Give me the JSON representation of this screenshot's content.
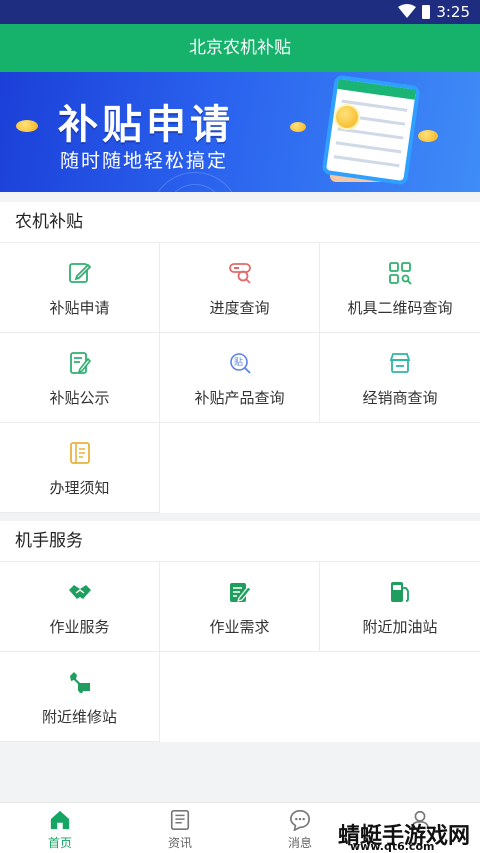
{
  "status_bar": {
    "time": "3:25"
  },
  "header": {
    "title": "北京农机补贴"
  },
  "banner": {
    "title": "补贴申请",
    "subtitle": "随时随地轻松搞定"
  },
  "sections": [
    {
      "title": "农机补贴",
      "items": [
        {
          "label": "补贴申请",
          "icon": "edit-icon"
        },
        {
          "label": "进度查询",
          "icon": "progress-search-icon"
        },
        {
          "label": "机具二维码查询",
          "icon": "qr-code-icon"
        },
        {
          "label": "补贴公示",
          "icon": "notice-icon"
        },
        {
          "label": "补贴产品查询",
          "icon": "product-search-icon"
        },
        {
          "label": "经销商查询",
          "icon": "store-icon"
        },
        {
          "label": "办理须知",
          "icon": "guide-icon"
        }
      ]
    },
    {
      "title": "机手服务",
      "items": [
        {
          "label": "作业服务",
          "icon": "handshake-icon"
        },
        {
          "label": "作业需求",
          "icon": "task-edit-icon"
        },
        {
          "label": "附近加油站",
          "icon": "gas-station-icon"
        },
        {
          "label": "附近维修站",
          "icon": "repair-icon"
        }
      ]
    }
  ],
  "tabs": [
    {
      "label": "首页",
      "icon": "home-icon",
      "active": true
    },
    {
      "label": "资讯",
      "icon": "news-icon",
      "active": false
    },
    {
      "label": "消息",
      "icon": "message-icon",
      "active": false
    },
    {
      "label": "",
      "icon": "user-icon",
      "active": false
    }
  ],
  "watermark": {
    "text": "蜻蜓手游戏网",
    "url": "www.qt6.com"
  },
  "colors": {
    "primary": "#16b26b",
    "status_bar": "#1f2d80",
    "banner": "#2a62ee",
    "icon_orange": "#e8b23c",
    "icon_red": "#e36a6a",
    "icon_teal": "#2fb6a3",
    "icon_blue": "#5b84e6"
  }
}
